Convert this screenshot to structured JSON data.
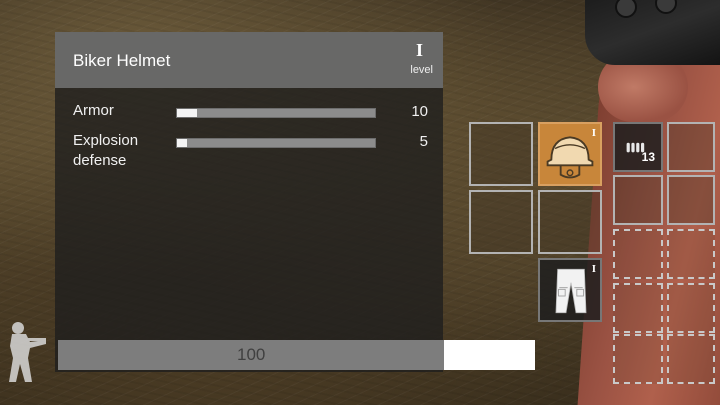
{
  "item": {
    "name": "Biker Helmet",
    "level_numeral": "I",
    "level_label": "level"
  },
  "stats": [
    {
      "label_line1": "Armor",
      "label_line2": "",
      "value": "10",
      "fill_fraction": 0.1
    },
    {
      "label_line1": "Explosion",
      "label_line2": "defense",
      "value": "5",
      "fill_fraction": 0.05
    }
  ],
  "capacity": {
    "value": "100",
    "used_fraction": 0.81
  },
  "slots": {
    "helmet_tier": "I",
    "pants_tier": "I",
    "ammo_count": "13"
  },
  "icons": {
    "helmet": "helmet-icon",
    "pants": "pants-icon",
    "ammo": "ammo-icon",
    "soldier": "soldier-aiming-icon"
  },
  "colors": {
    "selected_slot": "#c8863a",
    "panel_header": "#6e6e6e",
    "bar_fill": "#f4f4f4"
  }
}
